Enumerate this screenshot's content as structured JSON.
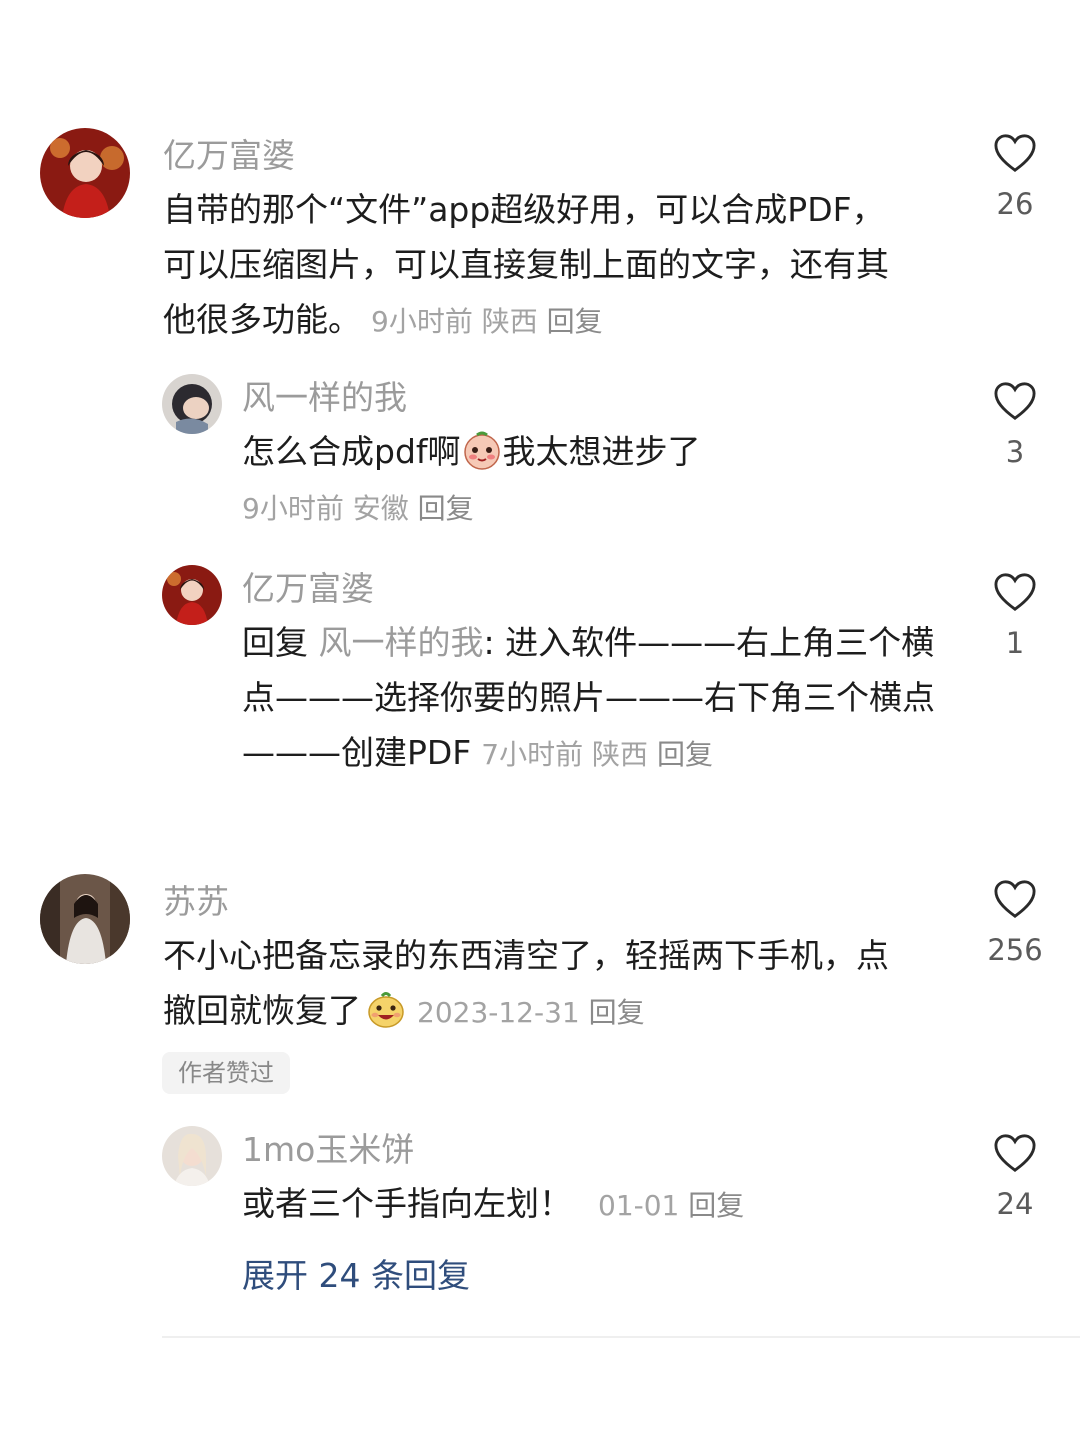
{
  "comments": [
    {
      "name": "亿万富婆",
      "text": "自带的那个“文件”app超级好用，可以合成PDF，可以压缩图片，可以直接复制上面的文字，还有其他很多功能。",
      "time": "9小时前",
      "location": "陕西",
      "reply_label": "回复",
      "likes": "26"
    },
    {
      "name": "风一样的我",
      "text_before_emoji": "怎么合成pdf啊",
      "text_after_emoji": "我太想进步了",
      "time": "9小时前",
      "location": "安徽",
      "reply_label": "回复",
      "likes": "3"
    },
    {
      "name": "亿万富婆",
      "reply_prefix": "回复",
      "mention": "风一样的我",
      "text": ": 进入软件———右上角三个横点———选择你要的照片———右下角三个横点———创建PDF",
      "time": "7小时前",
      "location": "陕西",
      "reply_label": "回复",
      "likes": "1"
    },
    {
      "name": "苏苏",
      "text": "不小心把备忘录的东西清空了，轻摇两下手机，点撤回就恢复了",
      "date": "2023-12-31",
      "reply_label": "回复",
      "likes": "256",
      "badge": "作者赞过"
    },
    {
      "name": "1mo玉米饼",
      "text": "或者三个手指向左划！",
      "date": "01-01",
      "reply_label": "回复",
      "likes": "24"
    }
  ],
  "expand_replies": "展开 24 条回复",
  "icons": {
    "like": "heart-outline-icon",
    "emoji_shy": "shy-face-emoji",
    "emoji_smile": "grin-face-emoji"
  }
}
